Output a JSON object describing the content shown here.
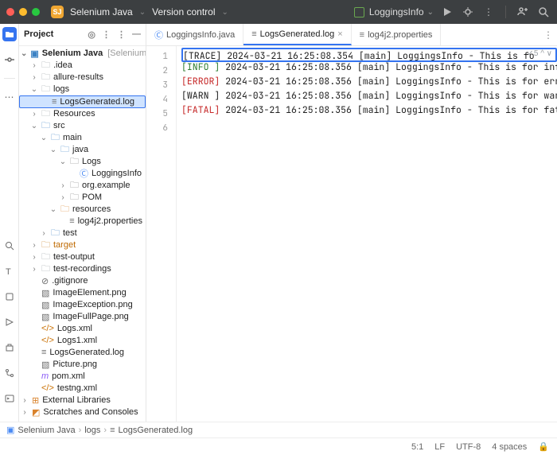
{
  "title": {
    "project": "Selenium Java",
    "vc": "Version control",
    "badge": "SJ",
    "runConfig": "LoggingsInfo"
  },
  "panel": {
    "title": "Project"
  },
  "tree": {
    "root": "Selenium Java",
    "rootCtx": "[SeleniumJava]",
    "idea": ".idea",
    "allure": "allure-results",
    "logs": "logs",
    "logsGen": "LogsGenerated.log",
    "resources": "Resources",
    "src": "src",
    "main": "main",
    "java": "java",
    "logsPkg": "Logs",
    "loggingInfo": "LoggingsInfo",
    "orgExample": "org.example",
    "pom": "POM",
    "resources2": "resources",
    "log4j2": "log4j2.properties",
    "test": "test",
    "target": "target",
    "testOutput": "test-output",
    "testRec": "test-recordings",
    "gitignore": ".gitignore",
    "imgEl": "ImageElement.png",
    "imgExc": "ImageException.png",
    "imgFull": "ImageFullPage.png",
    "logsxml": "Logs.xml",
    "logs1xml": "Logs1.xml",
    "logsGenR": "LogsGenerated.log",
    "picture": "Picture.png",
    "pomxml": "pom.xml",
    "testng": "testng.xml",
    "ext": "External Libraries",
    "scratch": "Scratches and Consoles"
  },
  "tabs": {
    "t1": "LoggingsInfo.java",
    "t2": "LogsGenerated.log",
    "t3": "log4j2.properties"
  },
  "log": {
    "lines": [
      {
        "n": 1,
        "level": "[TRACE]",
        "cls": "lv-trace",
        "ts": "2024-03-21 16:25:08.354",
        "rest": "[main] LoggingsInfo - This is fo"
      },
      {
        "n": 2,
        "level": "[INFO ]",
        "cls": "lv-info",
        "ts": "2024-03-21 16:25:08.356",
        "rest": "[main] LoggingsInfo - This is for infor"
      },
      {
        "n": 3,
        "level": "[ERROR]",
        "cls": "lv-error",
        "ts": "2024-03-21 16:25:08.356",
        "rest": "[main] LoggingsInfo - This is for error"
      },
      {
        "n": 4,
        "level": "[WARN ]",
        "cls": "lv-warn",
        "ts": "2024-03-21 16:25:08.356",
        "rest": "[main] LoggingsInfo - This is for warni"
      },
      {
        "n": 5,
        "level": "[FATAL]",
        "cls": "lv-fatal",
        "ts": "2024-03-21 16:25:08.356",
        "rest": "[main] LoggingsInfo - This is for fatal"
      }
    ],
    "overlay": "✓5 ^ ∨"
  },
  "crumbs": {
    "c1": "Selenium Java",
    "c2": "logs",
    "c3": "LogsGenerated.log"
  },
  "status": {
    "pos": "5:1",
    "lf": "LF",
    "enc": "UTF-8",
    "ind": "4 spaces"
  }
}
